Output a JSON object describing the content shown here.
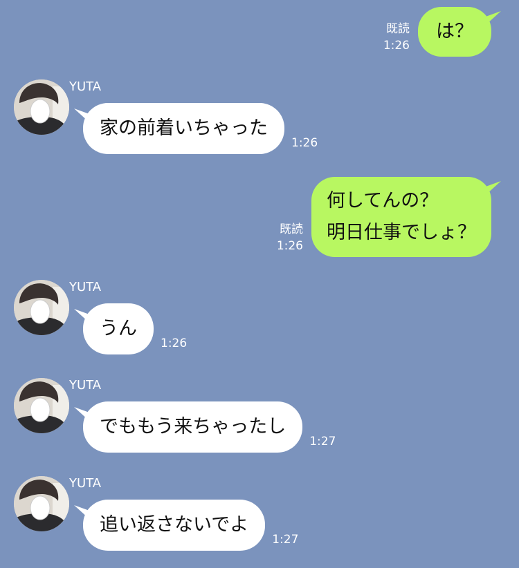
{
  "messages": [
    {
      "side": "out",
      "read_label": "既読",
      "time": "1:26",
      "lines": [
        "は？"
      ]
    },
    {
      "side": "in",
      "sender": "YUTA",
      "time": "1:26",
      "text": "家の前着いちゃった"
    },
    {
      "side": "out",
      "read_label": "既読",
      "time": "1:26",
      "lines": [
        "何してんの？",
        "明日仕事でしょ？"
      ]
    },
    {
      "side": "in",
      "sender": "YUTA",
      "time": "1:26",
      "text": "うん"
    },
    {
      "side": "in",
      "sender": "YUTA",
      "time": "1:27",
      "text": "でももう来ちゃったし"
    },
    {
      "side": "in",
      "sender": "YUTA",
      "time": "1:27",
      "text": "追い返さないでよ"
    }
  ],
  "colors": {
    "background": "#7b93bd",
    "outgoing_bubble": "#b8f761",
    "incoming_bubble": "#ffffff"
  }
}
